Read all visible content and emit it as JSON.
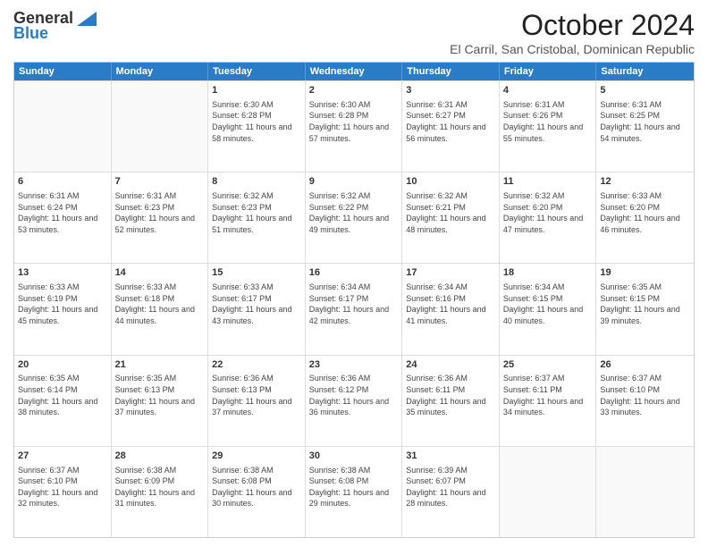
{
  "logo": {
    "general": "General",
    "blue": "Blue"
  },
  "header": {
    "month": "October 2024",
    "location": "El Carril, San Cristobal, Dominican Republic"
  },
  "days": [
    "Sunday",
    "Monday",
    "Tuesday",
    "Wednesday",
    "Thursday",
    "Friday",
    "Saturday"
  ],
  "weeks": [
    [
      {
        "day": "",
        "sunrise": "",
        "sunset": "",
        "daylight": "",
        "empty": true
      },
      {
        "day": "",
        "sunrise": "",
        "sunset": "",
        "daylight": "",
        "empty": true
      },
      {
        "day": "1",
        "sunrise": "Sunrise: 6:30 AM",
        "sunset": "Sunset: 6:28 PM",
        "daylight": "Daylight: 11 hours and 58 minutes."
      },
      {
        "day": "2",
        "sunrise": "Sunrise: 6:30 AM",
        "sunset": "Sunset: 6:28 PM",
        "daylight": "Daylight: 11 hours and 57 minutes."
      },
      {
        "day": "3",
        "sunrise": "Sunrise: 6:31 AM",
        "sunset": "Sunset: 6:27 PM",
        "daylight": "Daylight: 11 hours and 56 minutes."
      },
      {
        "day": "4",
        "sunrise": "Sunrise: 6:31 AM",
        "sunset": "Sunset: 6:26 PM",
        "daylight": "Daylight: 11 hours and 55 minutes."
      },
      {
        "day": "5",
        "sunrise": "Sunrise: 6:31 AM",
        "sunset": "Sunset: 6:25 PM",
        "daylight": "Daylight: 11 hours and 54 minutes."
      }
    ],
    [
      {
        "day": "6",
        "sunrise": "Sunrise: 6:31 AM",
        "sunset": "Sunset: 6:24 PM",
        "daylight": "Daylight: 11 hours and 53 minutes."
      },
      {
        "day": "7",
        "sunrise": "Sunrise: 6:31 AM",
        "sunset": "Sunset: 6:23 PM",
        "daylight": "Daylight: 11 hours and 52 minutes."
      },
      {
        "day": "8",
        "sunrise": "Sunrise: 6:32 AM",
        "sunset": "Sunset: 6:23 PM",
        "daylight": "Daylight: 11 hours and 51 minutes."
      },
      {
        "day": "9",
        "sunrise": "Sunrise: 6:32 AM",
        "sunset": "Sunset: 6:22 PM",
        "daylight": "Daylight: 11 hours and 49 minutes."
      },
      {
        "day": "10",
        "sunrise": "Sunrise: 6:32 AM",
        "sunset": "Sunset: 6:21 PM",
        "daylight": "Daylight: 11 hours and 48 minutes."
      },
      {
        "day": "11",
        "sunrise": "Sunrise: 6:32 AM",
        "sunset": "Sunset: 6:20 PM",
        "daylight": "Daylight: 11 hours and 47 minutes."
      },
      {
        "day": "12",
        "sunrise": "Sunrise: 6:33 AM",
        "sunset": "Sunset: 6:20 PM",
        "daylight": "Daylight: 11 hours and 46 minutes."
      }
    ],
    [
      {
        "day": "13",
        "sunrise": "Sunrise: 6:33 AM",
        "sunset": "Sunset: 6:19 PM",
        "daylight": "Daylight: 11 hours and 45 minutes."
      },
      {
        "day": "14",
        "sunrise": "Sunrise: 6:33 AM",
        "sunset": "Sunset: 6:18 PM",
        "daylight": "Daylight: 11 hours and 44 minutes."
      },
      {
        "day": "15",
        "sunrise": "Sunrise: 6:33 AM",
        "sunset": "Sunset: 6:17 PM",
        "daylight": "Daylight: 11 hours and 43 minutes."
      },
      {
        "day": "16",
        "sunrise": "Sunrise: 6:34 AM",
        "sunset": "Sunset: 6:17 PM",
        "daylight": "Daylight: 11 hours and 42 minutes."
      },
      {
        "day": "17",
        "sunrise": "Sunrise: 6:34 AM",
        "sunset": "Sunset: 6:16 PM",
        "daylight": "Daylight: 11 hours and 41 minutes."
      },
      {
        "day": "18",
        "sunrise": "Sunrise: 6:34 AM",
        "sunset": "Sunset: 6:15 PM",
        "daylight": "Daylight: 11 hours and 40 minutes."
      },
      {
        "day": "19",
        "sunrise": "Sunrise: 6:35 AM",
        "sunset": "Sunset: 6:15 PM",
        "daylight": "Daylight: 11 hours and 39 minutes."
      }
    ],
    [
      {
        "day": "20",
        "sunrise": "Sunrise: 6:35 AM",
        "sunset": "Sunset: 6:14 PM",
        "daylight": "Daylight: 11 hours and 38 minutes."
      },
      {
        "day": "21",
        "sunrise": "Sunrise: 6:35 AM",
        "sunset": "Sunset: 6:13 PM",
        "daylight": "Daylight: 11 hours and 37 minutes."
      },
      {
        "day": "22",
        "sunrise": "Sunrise: 6:36 AM",
        "sunset": "Sunset: 6:13 PM",
        "daylight": "Daylight: 11 hours and 37 minutes."
      },
      {
        "day": "23",
        "sunrise": "Sunrise: 6:36 AM",
        "sunset": "Sunset: 6:12 PM",
        "daylight": "Daylight: 11 hours and 36 minutes."
      },
      {
        "day": "24",
        "sunrise": "Sunrise: 6:36 AM",
        "sunset": "Sunset: 6:11 PM",
        "daylight": "Daylight: 11 hours and 35 minutes."
      },
      {
        "day": "25",
        "sunrise": "Sunrise: 6:37 AM",
        "sunset": "Sunset: 6:11 PM",
        "daylight": "Daylight: 11 hours and 34 minutes."
      },
      {
        "day": "26",
        "sunrise": "Sunrise: 6:37 AM",
        "sunset": "Sunset: 6:10 PM",
        "daylight": "Daylight: 11 hours and 33 minutes."
      }
    ],
    [
      {
        "day": "27",
        "sunrise": "Sunrise: 6:37 AM",
        "sunset": "Sunset: 6:10 PM",
        "daylight": "Daylight: 11 hours and 32 minutes."
      },
      {
        "day": "28",
        "sunrise": "Sunrise: 6:38 AM",
        "sunset": "Sunset: 6:09 PM",
        "daylight": "Daylight: 11 hours and 31 minutes."
      },
      {
        "day": "29",
        "sunrise": "Sunrise: 6:38 AM",
        "sunset": "Sunset: 6:08 PM",
        "daylight": "Daylight: 11 hours and 30 minutes."
      },
      {
        "day": "30",
        "sunrise": "Sunrise: 6:38 AM",
        "sunset": "Sunset: 6:08 PM",
        "daylight": "Daylight: 11 hours and 29 minutes."
      },
      {
        "day": "31",
        "sunrise": "Sunrise: 6:39 AM",
        "sunset": "Sunset: 6:07 PM",
        "daylight": "Daylight: 11 hours and 28 minutes."
      },
      {
        "day": "",
        "sunrise": "",
        "sunset": "",
        "daylight": "",
        "empty": true
      },
      {
        "day": "",
        "sunrise": "",
        "sunset": "",
        "daylight": "",
        "empty": true
      }
    ]
  ]
}
